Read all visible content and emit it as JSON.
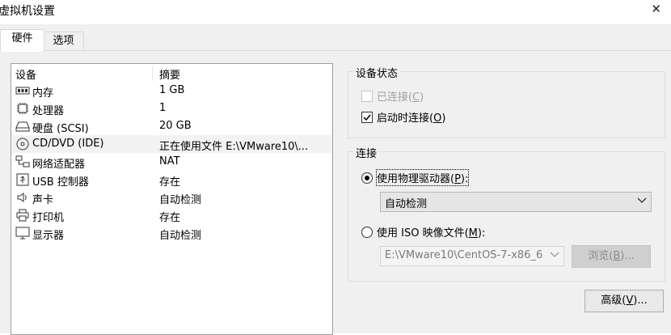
{
  "window": {
    "title": "虚拟机设置",
    "close_glyph": "✕"
  },
  "tabs": [
    {
      "label": "硬件"
    },
    {
      "label": "选项"
    }
  ],
  "hardware_list": {
    "headers": {
      "device": "设备",
      "summary": "摘要"
    },
    "rows": [
      {
        "icon": "memory-icon",
        "name": "内存",
        "summary": "1 GB"
      },
      {
        "icon": "processor-icon",
        "name": "处理器",
        "summary": "1"
      },
      {
        "icon": "hard-disk-icon",
        "name": "硬盘 (SCSI)",
        "summary": "20 GB"
      },
      {
        "icon": "cd-dvd-icon",
        "name": "CD/DVD (IDE)",
        "summary": "正在使用文件 E:\\VMware10\\..."
      },
      {
        "icon": "network-adapter-icon",
        "name": "网络适配器",
        "summary": "NAT"
      },
      {
        "icon": "usb-controller-icon",
        "name": "USB 控制器",
        "summary": "存在"
      },
      {
        "icon": "sound-card-icon",
        "name": "声卡",
        "summary": "自动检测"
      },
      {
        "icon": "printer-icon",
        "name": "打印机",
        "summary": "存在"
      },
      {
        "icon": "display-icon",
        "name": "显示器",
        "summary": "自动检测"
      }
    ]
  },
  "device_status": {
    "title": "设备状态",
    "connected": {
      "label_pre": "已连接(",
      "mnemonic": "C",
      "label_post": ")",
      "checked": false,
      "enabled": false
    },
    "connect_at_power_on": {
      "label_pre": "启动时连接(",
      "mnemonic": "O",
      "label_post": ")",
      "checked": true
    }
  },
  "connection": {
    "title": "连接",
    "physical": {
      "label_pre": "使用物理驱动器(",
      "mnemonic": "P",
      "label_post": "):",
      "selected": true
    },
    "physical_drive_value": "自动检测",
    "iso": {
      "label_pre": "使用 ISO 映像文件(",
      "mnemonic": "M",
      "label_post": "):",
      "selected": false
    },
    "iso_path_value": "E:\\VMware10\\CentOS-7-x86_6",
    "browse_button": {
      "label_pre": "浏览(",
      "mnemonic": "B",
      "label_post": ")..."
    }
  },
  "advanced_button": {
    "label_pre": "高级(",
    "mnemonic": "V",
    "label_post": ")..."
  },
  "colors": {
    "panel_bg": "#f0f0f0",
    "selected_row": "#f2f2f2",
    "disabled_text": "#a0a0a0"
  }
}
